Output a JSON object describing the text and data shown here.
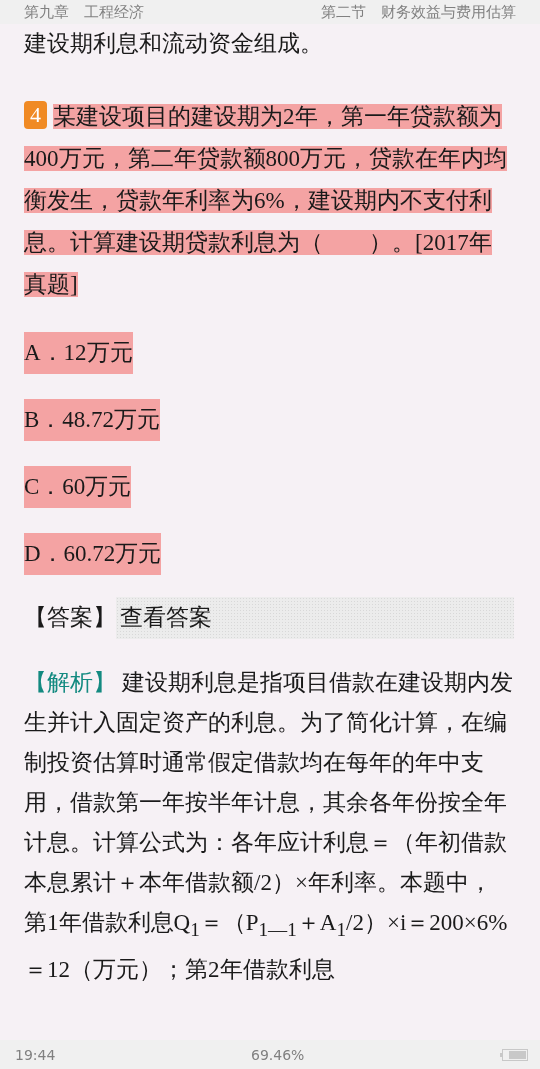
{
  "header": {
    "chapter": "第九章　工程经济",
    "section": "第二节　财务效益与费用估算"
  },
  "previous_text": "建设期利息和流动资金组成。",
  "question": {
    "number": "4",
    "text": "某建设项目的建设期为2年，第一年贷款额为400万元，第二年贷款额800万元，贷款在年内均衡发生，贷款年利率为6%，建设期内不支付利息。计算建设期贷款利息为（　　）。[2017年真题]",
    "highlighted": true
  },
  "options": [
    {
      "text": "A．12万元",
      "highlighted": true
    },
    {
      "text": "B．48.72万元",
      "highlighted": true
    },
    {
      "text": "C．60万元",
      "highlighted": true
    },
    {
      "text": "D．60.72万元",
      "highlighted": true
    }
  ],
  "answer": {
    "label": "【答案】",
    "button": "查看答案"
  },
  "analysis": {
    "label": "【解析】",
    "text": "建设期利息是指项目借款在建设期内发生并计入固定资产的利息。为了简化计算，在编制投资估算时通常假定借款均在每年的年中支用，借款第一年按半年计息，其余各年份按全年计息。计算公式为：各年应计利息＝（年初借款本息累计＋本年借款额/2）×年利率。本题中，第1年借款利息Q$_{1}$＝（P$_{1—1}$＋A$_{1}$/2）×i＝200×6%＝12（万元）；第2年借款利息"
  },
  "status_bar": {
    "time": "19:44",
    "progress": "69.46%"
  }
}
